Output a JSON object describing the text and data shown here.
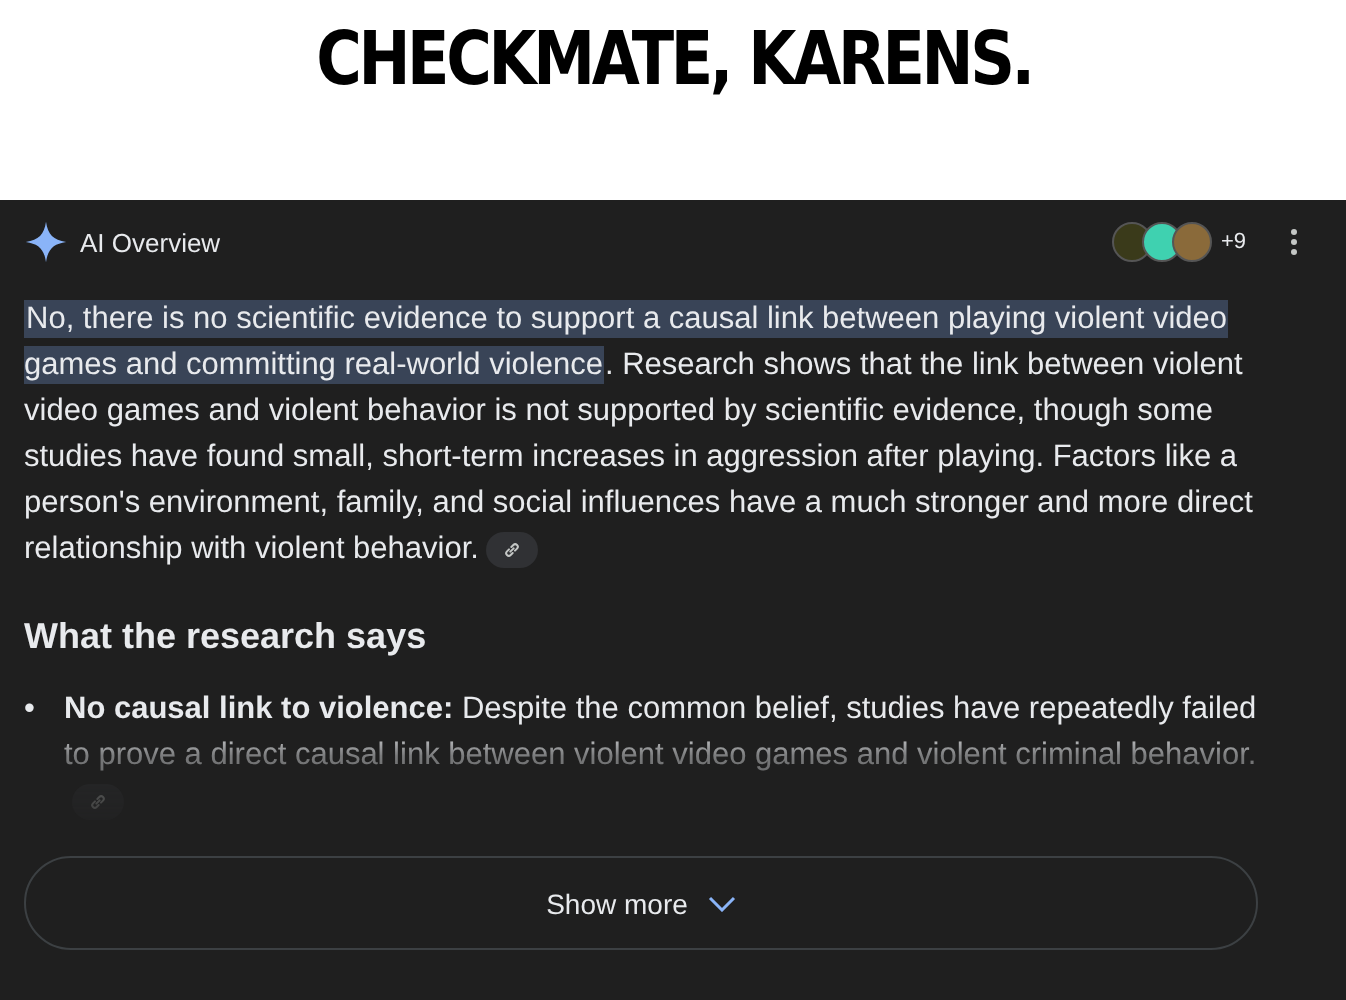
{
  "caption": "CHECKMATE, KARENS.",
  "overview": {
    "title": "AI Overview",
    "sources": [
      {
        "color": "#3a3a1a"
      },
      {
        "color": "#3fd1b0"
      },
      {
        "color": "#8a6a3a"
      }
    ],
    "source_count": "+9",
    "highlighted": "No, there is no scientific evidence to support a causal link between playing violent video games and committing real-world violence",
    "paragraph_rest": ". Research shows that the link between violent video games and violent behavior is not supported by scientific evidence, though some studies have found small, short-term increases in aggression after playing. Factors like a person's environment, family, and social influences have a much stronger and more direct relationship with violent behavior.",
    "heading": "What the research says",
    "bullets": [
      {
        "marker": "•",
        "text": "**No causal link to violence:** Despite the common belief, studies have repeatedly failed to prove a direct causal link between violent video games and violent criminal behavior."
      }
    ],
    "show_more": "Show more"
  }
}
